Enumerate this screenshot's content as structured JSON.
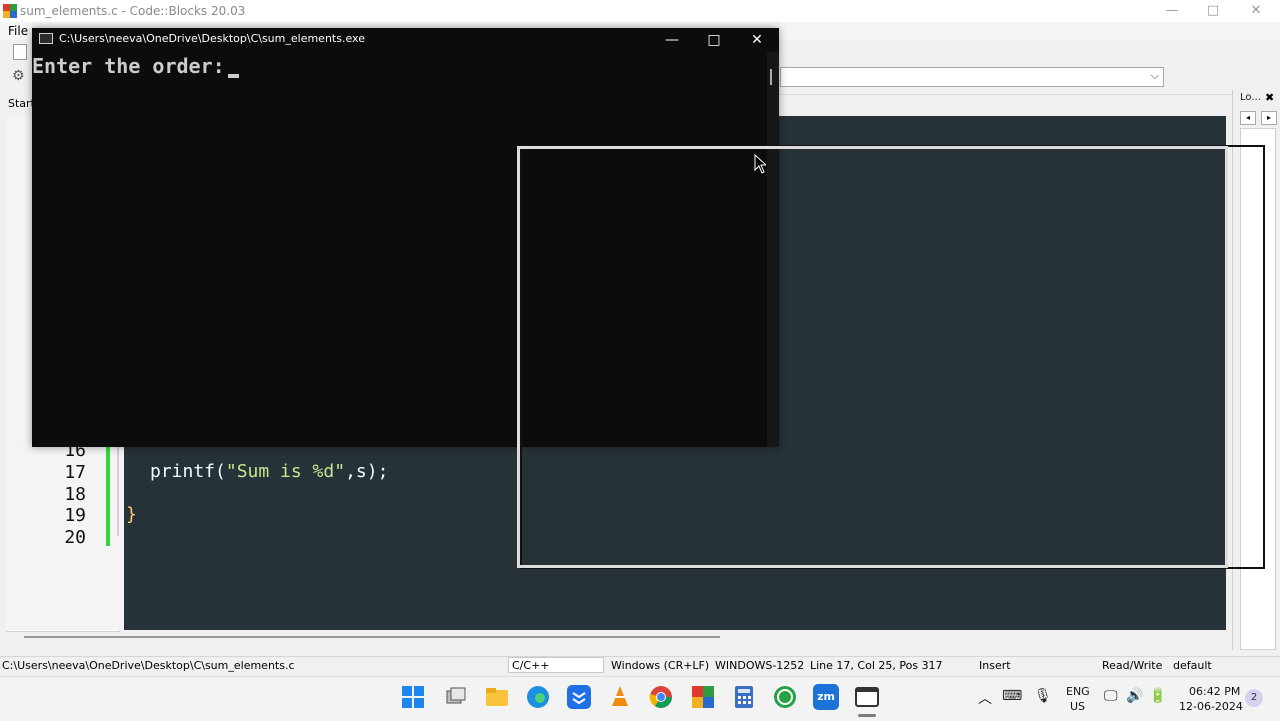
{
  "ide": {
    "title": "sum_elements.c - Code::Blocks 20.03",
    "menu_file": "File",
    "start_tab": "Start",
    "right_panel_tab": "Lo...",
    "minimize": "—",
    "maximize": "□",
    "close": "✕"
  },
  "editor": {
    "lines": [
      {
        "num": "16",
        "code": ""
      },
      {
        "num": "17",
        "code": "printf(\"Sum is %d\",s);"
      },
      {
        "num": "18",
        "code": ""
      },
      {
        "num": "19",
        "code": "}"
      },
      {
        "num": "20",
        "code": ""
      }
    ],
    "line17_a": "printf(",
    "line17_str": "\"Sum is %d\"",
    "line17_b": ",s);",
    "line19_brace": "}"
  },
  "console": {
    "title": "C:\\Users\\neeva\\OneDrive\\Desktop\\C\\sum_elements.exe",
    "prompt": "Enter the order:",
    "minimize": "—",
    "maximize": "□",
    "close": "✕"
  },
  "statusbar": {
    "path": "C:\\Users\\neeva\\OneDrive\\Desktop\\C\\sum_elements.c",
    "language": "C/C++",
    "line_endings": "Windows (CR+LF)",
    "encoding": "WINDOWS-1252",
    "position": "Line 17, Col 25, Pos 317",
    "mode": "Insert",
    "access": "Read/Write",
    "profile": "default"
  },
  "taskbar": {
    "lang_top": "ENG",
    "lang_bottom": "US",
    "time": "06:42 PM",
    "date": "12-06-2024",
    "notifications": "2",
    "zoom_label": "zm"
  },
  "colors": {
    "editor_bg": "#263238",
    "console_bg": "#0c0c0c",
    "string": "#c3e88d",
    "change_marker": "#35d43f"
  }
}
